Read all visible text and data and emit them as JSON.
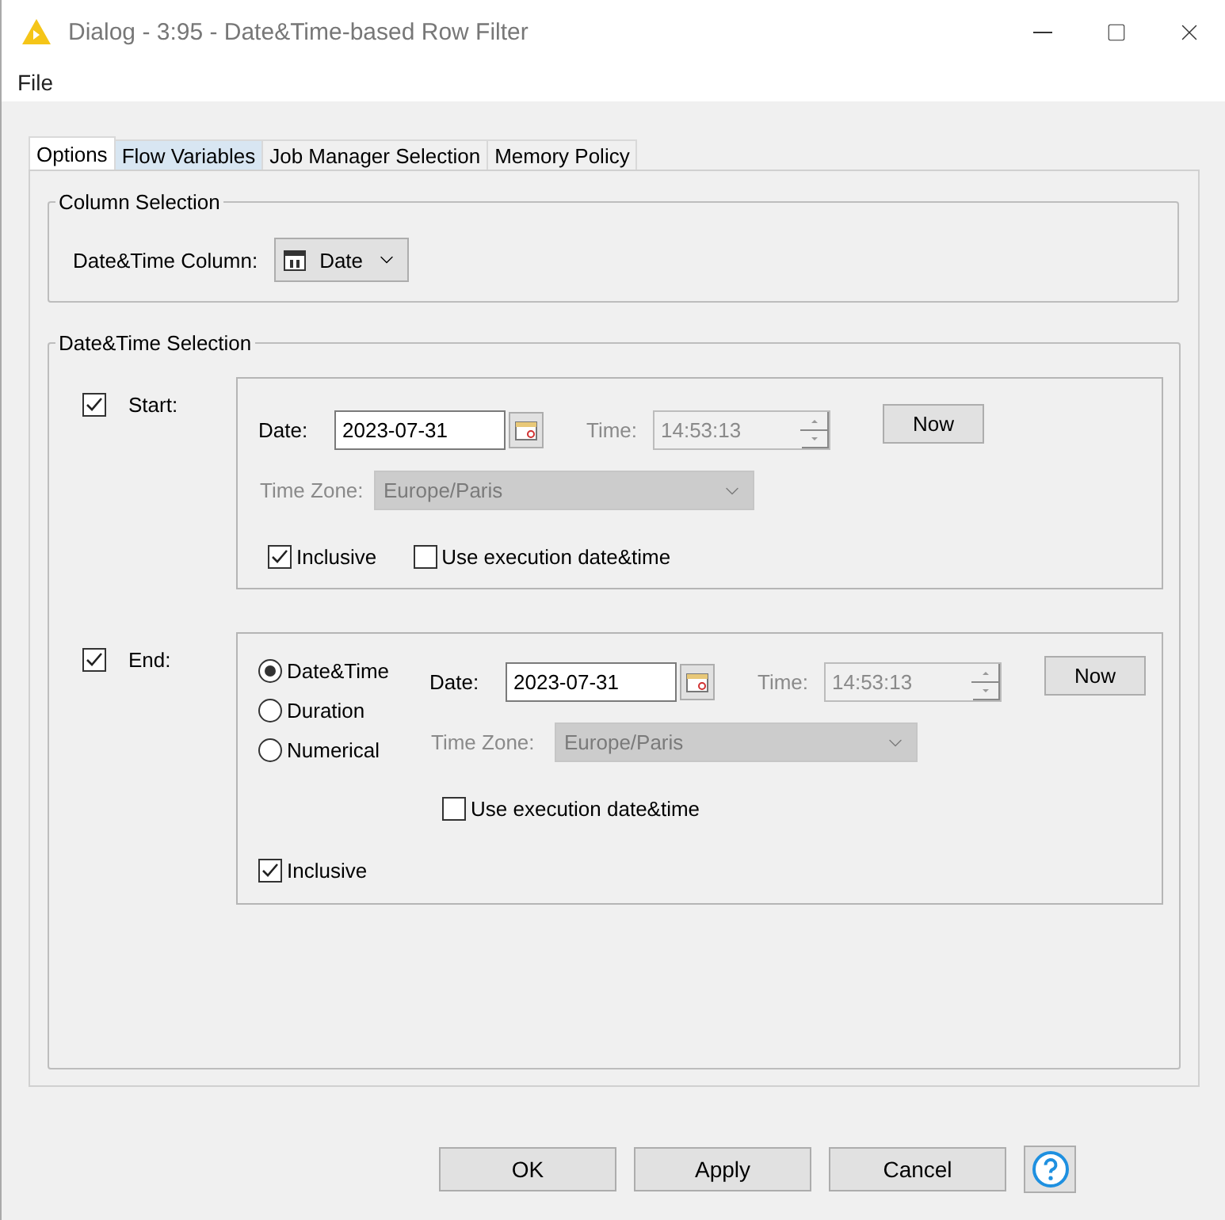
{
  "window": {
    "title": "Dialog - 3:95 - Date&Time-based Row Filter"
  },
  "menu": [
    "File"
  ],
  "tabs": [
    {
      "label": "Options",
      "selected": true,
      "highlighted": false
    },
    {
      "label": "Flow Variables",
      "selected": false,
      "highlighted": true
    },
    {
      "label": "Job Manager Selection",
      "selected": false,
      "highlighted": false
    },
    {
      "label": "Memory Policy",
      "selected": false,
      "highlighted": false
    }
  ],
  "column_selection": {
    "title": "Column Selection",
    "label": "Date&Time Column:",
    "value": "Date"
  },
  "datetime_selection": {
    "title": "Date&Time Selection",
    "start": {
      "enabled": true,
      "label": "Start:",
      "date_label": "Date:",
      "date": "2023-07-31",
      "time_label": "Time:",
      "time": "14:53:13",
      "time_disabled": true,
      "now": "Now",
      "timezone_label": "Time Zone:",
      "timezone": "Europe/Paris",
      "timezone_disabled": true,
      "inclusive": {
        "label": "Inclusive",
        "checked": true
      },
      "use_execution": {
        "label": "Use execution date&time",
        "checked": false
      }
    },
    "end": {
      "enabled": true,
      "label": "End:",
      "modes": [
        {
          "label": "Date&Time",
          "selected": true
        },
        {
          "label": "Duration",
          "selected": false
        },
        {
          "label": "Numerical",
          "selected": false
        }
      ],
      "date_label": "Date:",
      "date": "2023-07-31",
      "time_label": "Time:",
      "time": "14:53:13",
      "time_disabled": true,
      "now": "Now",
      "timezone_label": "Time Zone:",
      "timezone": "Europe/Paris",
      "timezone_disabled": true,
      "use_execution": {
        "label": "Use execution date&time",
        "checked": false
      },
      "inclusive": {
        "label": "Inclusive",
        "checked": true
      }
    }
  },
  "buttons": [
    "OK",
    "Apply",
    "Cancel"
  ]
}
